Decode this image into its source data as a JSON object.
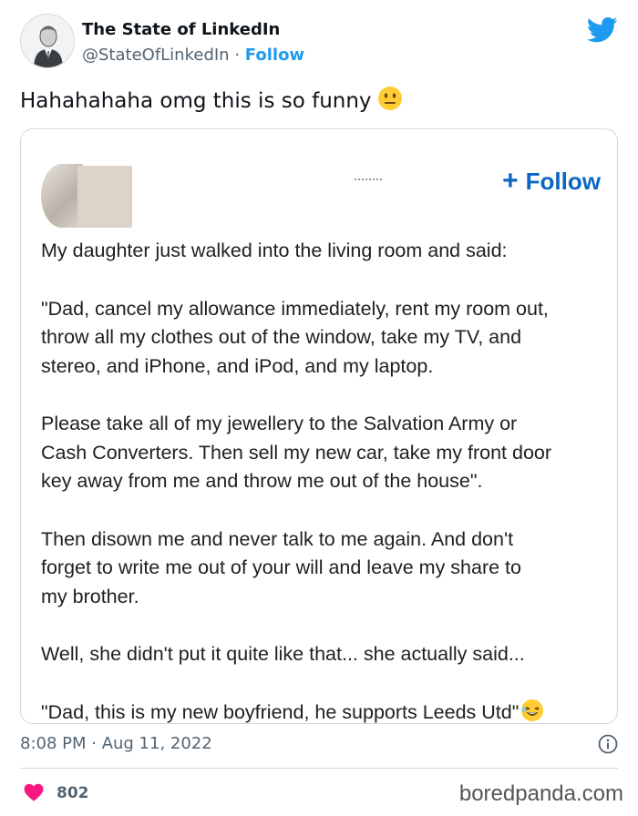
{
  "author": {
    "name": "The State of LinkedIn",
    "handle": "@StateOfLinkedIn",
    "separator": "·",
    "follow_label": "Follow"
  },
  "tweet": {
    "text": "Hahahahaha omg this is so funny",
    "emoji": "neutral-face-icon"
  },
  "embedded_post": {
    "follow_label": "Follow",
    "paragraphs": [
      [
        "My daughter just walked into the living room and said:"
      ],
      [
        "\"Dad, cancel my allowance immediately, rent my room out,",
        "throw all my clothes out of the window, take my TV, and",
        "stereo, and iPhone, and iPod, and my laptop."
      ],
      [
        "Please take all of my jewellery to the Salvation Army or",
        "Cash Converters. Then sell my new car, take my front door",
        "key away from me and throw me out of the house\"."
      ],
      [
        "Then disown me and never talk to me again. And don't",
        "forget to write me out of your will and leave my share to",
        "my brother."
      ],
      [
        "Well, she didn't put it quite like that... she actually said..."
      ],
      [
        "\"Dad, this is my new boyfriend, he supports Leeds Utd\""
      ]
    ]
  },
  "meta": {
    "timestamp": "8:08 PM · Aug 11, 2022",
    "likes": "802"
  },
  "watermark": "boredpanda.com",
  "colors": {
    "twitter_blue": "#1d9bf0",
    "linkedin_blue": "#0a66c2",
    "like_pink": "#f91880"
  }
}
